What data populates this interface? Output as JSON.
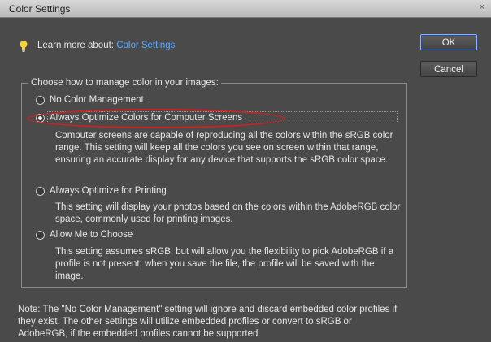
{
  "window": {
    "title": "Color Settings",
    "close_glyph": "×"
  },
  "learn": {
    "prefix": "Learn more about:",
    "link": "Color Settings"
  },
  "buttons": {
    "ok": "OK",
    "cancel": "Cancel"
  },
  "group": {
    "legend": "Choose how to manage color in your images:",
    "options": [
      {
        "label": "No Color Management",
        "selected": false,
        "description": ""
      },
      {
        "label": "Always Optimize Colors for Computer Screens",
        "selected": true,
        "description": "Computer screens are capable of reproducing all the colors within the sRGB color range. This setting will keep all the colors you see on screen within that range, ensuring an accurate display for any device that supports the sRGB color space."
      },
      {
        "label": "Always Optimize for Printing",
        "selected": false,
        "description": "This setting will display your photos based on the colors within the AdobeRGB color space, commonly used for printing images."
      },
      {
        "label": "Allow Me to Choose",
        "selected": false,
        "description": "This setting assumes sRGB, but will allow you the flexibility to pick AdobeRGB if a profile is not present; when you save the file, the profile will be saved with the image."
      }
    ]
  },
  "note": "Note: The \"No Color Management\" setting will ignore and discard embedded color profiles if they exist. The other settings will utilize embedded profiles or convert to sRGB or AdobeRGB, if the embedded profiles cannot be supported.",
  "colors": {
    "link": "#5aa9ff",
    "highlight_ring": "#d22020",
    "dialog_bg": "#4a4a4a"
  },
  "icons": {
    "lightbulb": "lightbulb-icon",
    "close": "close-icon"
  }
}
